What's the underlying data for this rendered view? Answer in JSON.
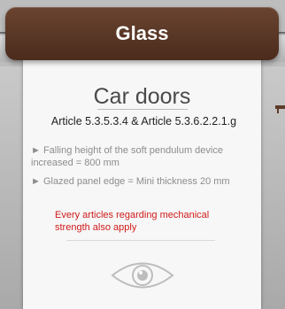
{
  "header": {
    "title": "Glass"
  },
  "card": {
    "heading": "Car doors",
    "article": "Article 5.3.5.3.4 & Article 5.3.6.2.2.1.g",
    "bullets": [
      {
        "arrow": "►",
        "text": "Falling height of the soft pendulum device increased = 800 mm"
      },
      {
        "arrow": "►",
        "text": "Glazed panel edge = Mini thickness 20 mm"
      }
    ],
    "note": "Every articles regarding mechanical strength also apply",
    "icon": "eye-icon"
  },
  "colors": {
    "header_brown": "#5a3625",
    "note_red": "#d11a1a",
    "text_gray": "#8c8c8c"
  }
}
